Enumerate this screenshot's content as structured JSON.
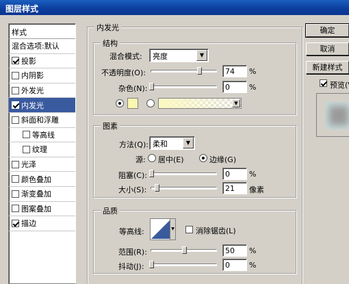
{
  "window_title": "图层样式",
  "sidebar": {
    "header": "样式",
    "items": [
      {
        "label": "混合选项:默认",
        "check": "none",
        "indent": false,
        "selected": false
      },
      {
        "label": "投影",
        "check": "on",
        "indent": false,
        "selected": false
      },
      {
        "label": "内阴影",
        "check": "off",
        "indent": false,
        "selected": false
      },
      {
        "label": "外发光",
        "check": "off",
        "indent": false,
        "selected": false
      },
      {
        "label": "内发光",
        "check": "on",
        "indent": false,
        "selected": true
      },
      {
        "label": "斜面和浮雕",
        "check": "off",
        "indent": false,
        "selected": false
      },
      {
        "label": "等高线",
        "check": "off",
        "indent": true,
        "selected": false
      },
      {
        "label": "纹理",
        "check": "off",
        "indent": true,
        "selected": false
      },
      {
        "label": "光泽",
        "check": "off",
        "indent": false,
        "selected": false
      },
      {
        "label": "颜色叠加",
        "check": "off",
        "indent": false,
        "selected": false
      },
      {
        "label": "渐变叠加",
        "check": "off",
        "indent": false,
        "selected": false
      },
      {
        "label": "图案叠加",
        "check": "off",
        "indent": false,
        "selected": false
      },
      {
        "label": "描边",
        "check": "on",
        "indent": false,
        "selected": false
      }
    ]
  },
  "panel_title": "内发光",
  "structure": {
    "title": "结构",
    "blend_mode_label": "混合模式:",
    "blend_mode_value": "亮度",
    "opacity_label": "不透明度(O):",
    "opacity_value": "74",
    "opacity_level": 0.74,
    "opacity_unit": "%",
    "noise_label": "杂色(N):",
    "noise_value": "0",
    "noise_level": 0,
    "noise_unit": "%",
    "solid_color": "#fbf7b0",
    "gradient_color": "#fcf9c0"
  },
  "elements": {
    "title": "图素",
    "technique_label": "方法(Q):",
    "technique_value": "柔和",
    "source_label": "源:",
    "source_center": "居中(E)",
    "source_edge": "边缘(G)",
    "choke_label": "阻塞(C):",
    "choke_value": "0",
    "choke_level": 0,
    "choke_unit": "%",
    "size_label": "大小(S):",
    "size_value": "21",
    "size_level": 0.084,
    "size_unit": "像素"
  },
  "quality": {
    "title": "品质",
    "contour_label": "等高线:",
    "anti_alias_label": "消除锯齿(L)",
    "range_label": "范围(R):",
    "range_value": "50",
    "range_level": 0.5,
    "range_unit": "%",
    "jitter_label": "抖动(J):",
    "jitter_value": "0",
    "jitter_level": 0,
    "jitter_unit": "%"
  },
  "buttons": {
    "ok": "确定",
    "cancel": "取消",
    "new_style": "新建样式(W)...",
    "preview": "预览(V)"
  }
}
